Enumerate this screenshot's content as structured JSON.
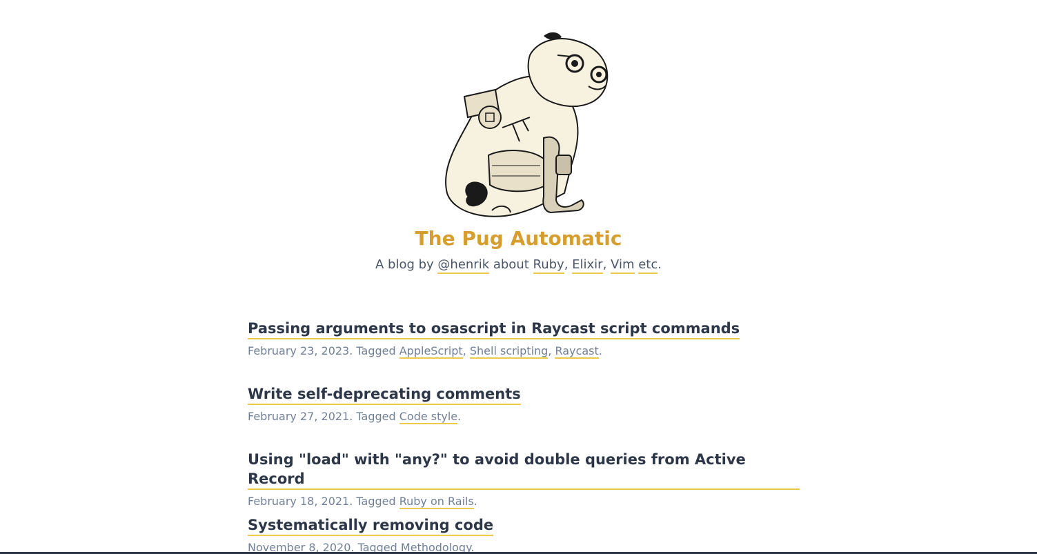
{
  "site": {
    "title": "The Pug Automatic",
    "tagline_prefix": "A blog by ",
    "author": "@henrik",
    "tagline_mid": " about ",
    "topics": [
      "Ruby",
      "Elixir",
      "Vim",
      "etc"
    ],
    "sep1": ", ",
    "sep2": ", ",
    "sep3": " ",
    "tagline_end": "."
  },
  "logo": {
    "icon": "mechanical-pug-illustration",
    "fill_color": "#f7f1df",
    "stroke_color": "#1a1a1a"
  },
  "accent_color": "#ecc94b",
  "title_color": "#d69e2e",
  "posts": [
    {
      "title": "Passing arguments to osascript in Raycast script commands",
      "date": "February 23, 2023",
      "tagged": ". Tagged ",
      "tags": [
        "AppleScript",
        "Shell scripting",
        "Raycast"
      ],
      "end": "."
    },
    {
      "title": "Write self-deprecating comments",
      "date": "February 27, 2021",
      "tagged": ". Tagged ",
      "tags": [
        "Code style"
      ],
      "end": "."
    },
    {
      "title": "Using \"load\" with \"any?\" to avoid double queries from Active Record",
      "date": "February 18, 2021",
      "tagged": ". Tagged ",
      "tags": [
        "Ruby on Rails"
      ],
      "end": "."
    },
    {
      "title": "Systematically removing code",
      "date": "November 8, 2020",
      "tagged": ". Tagged ",
      "tags": [
        "Methodology"
      ],
      "end": "."
    }
  ],
  "comma": ", "
}
